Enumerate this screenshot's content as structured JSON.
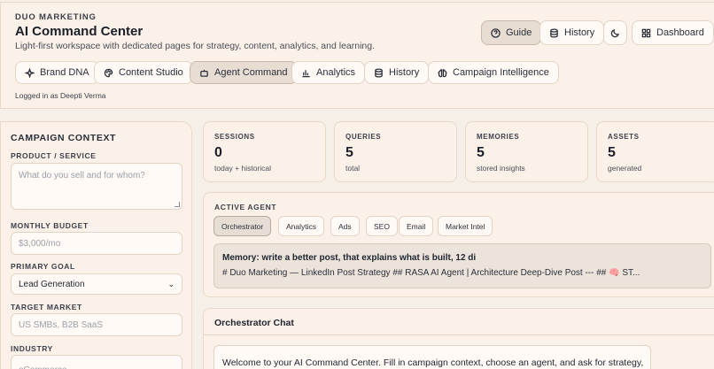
{
  "header": {
    "brand_small": "DUO MARKETING",
    "title": "AI Command Center",
    "subtitle": "Light-first workspace with dedicated pages for strategy, content, analytics, and learning.",
    "logged_in": "Logged in as Deepti Verma",
    "actions": {
      "guide": "Guide",
      "history": "History",
      "dashboard": "Dashboard"
    }
  },
  "nav": {
    "brand_dna": "Brand DNA",
    "content_studio": "Content Studio",
    "agent_command": "Agent Command",
    "analytics": "Analytics",
    "history": "History",
    "campaign_intelligence": "Campaign Intelligence"
  },
  "sidebar": {
    "title": "CAMPAIGN CONTEXT",
    "product_label": "PRODUCT / SERVICE",
    "product_placeholder": "What do you sell and for whom?",
    "budget_label": "MONTHLY BUDGET",
    "budget_placeholder": "$3,000/mo",
    "goal_label": "PRIMARY GOAL",
    "goal_value": "Lead Generation",
    "market_label": "TARGET MARKET",
    "market_placeholder": "US SMBs, B2B SaaS",
    "industry_label": "INDUSTRY",
    "industry_placeholder": "eCommerce"
  },
  "stats": {
    "sessions": {
      "label": "SESSIONS",
      "value": "0",
      "sub": "today + historical"
    },
    "queries": {
      "label": "QUERIES",
      "value": "5",
      "sub": "total"
    },
    "memories": {
      "label": "MEMORIES",
      "value": "5",
      "sub": "stored insights"
    },
    "assets": {
      "label": "ASSETS",
      "value": "5",
      "sub": "generated"
    }
  },
  "agent": {
    "title": "ACTIVE AGENT",
    "chips": {
      "orchestrator": "Orchestrator",
      "analytics": "Analytics",
      "ads": "Ads",
      "seo": "SEO",
      "email": "Email",
      "market_intel": "Market Intel"
    },
    "memory_title": "Memory: write a better post, that explains what is built, 12 di",
    "memory_body": "# Duo Marketing — LinkedIn Post Strategy ## RASA AI Agent | Architecture Deep-Dive Post --- ## 🧠 ST..."
  },
  "chat": {
    "title": "Orchestrator Chat",
    "message": "Welcome to your AI Command Center. Fill in campaign context, choose an agent, and ask for strategy,"
  },
  "colors": {
    "background": "#f5efe8",
    "card": "#fbf1e8",
    "active_pill": "#e8ddd3"
  }
}
